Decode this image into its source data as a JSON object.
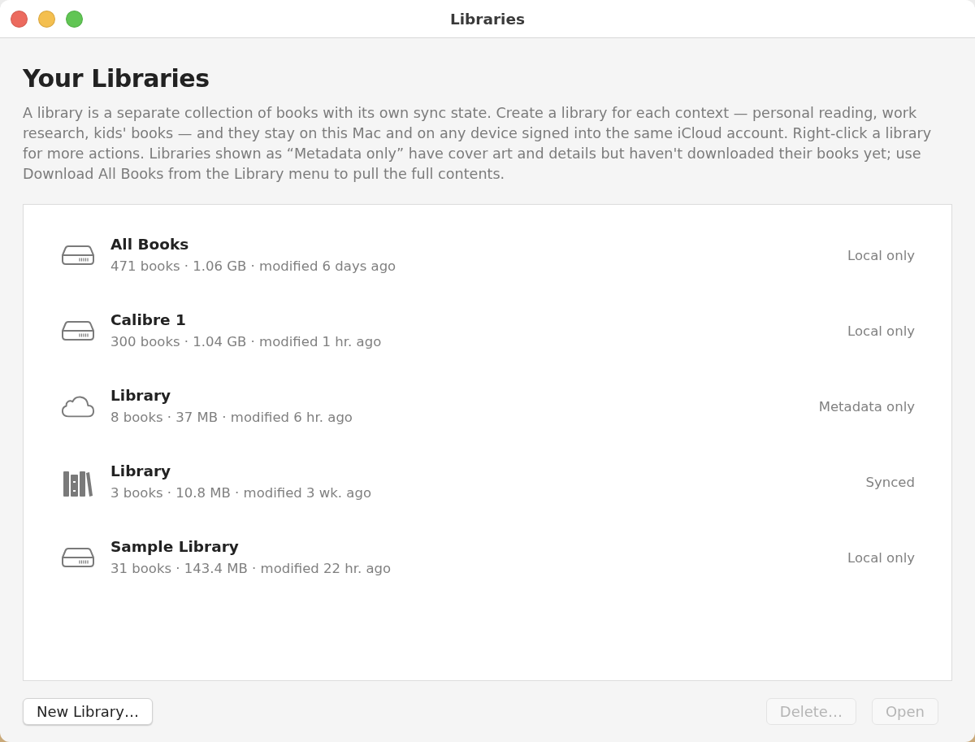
{
  "window": {
    "title": "Libraries"
  },
  "heading": "Your Libraries",
  "description": "A library is a separate collection of books with its own sync state. Create a library for each context — personal reading, work research, kids' books — and they stay on this Mac and on any device signed into the same iCloud account. Right-click a library for more actions. Libraries shown as “Metadata only” have cover art and details but haven't downloaded their books yet; use Download All Books from the Library menu to pull the full contents.",
  "libraries": [
    {
      "kind": "drive",
      "name": "All Books",
      "details": "471 books · 1.06 GB · modified 6 days ago",
      "status": "Local only"
    },
    {
      "kind": "drive",
      "name": "Calibre 1",
      "details": "300 books · 1.04 GB · modified 1 hr. ago",
      "status": "Local only"
    },
    {
      "kind": "cloud",
      "name": "Library",
      "details": "8 books · 37 MB · modified 6 hr. ago",
      "status": "Metadata only"
    },
    {
      "kind": "shelf",
      "name": "Library",
      "details": "3 books · 10.8 MB · modified 3 wk. ago",
      "status": "Synced"
    },
    {
      "kind": "drive",
      "name": "Sample Library",
      "details": "31 books · 143.4 MB · modified 22 hr. ago",
      "status": "Local only"
    }
  ],
  "buttons": [
    {
      "label": "New Library…",
      "disabled": false
    },
    {
      "label": "Delete…",
      "disabled": true
    },
    {
      "label": "Open",
      "disabled": true
    }
  ]
}
